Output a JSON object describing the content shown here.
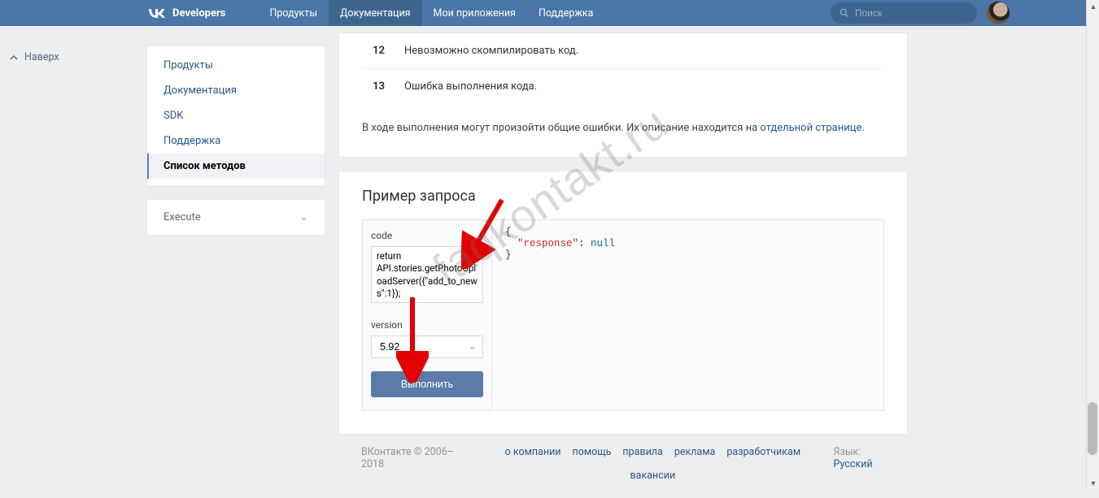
{
  "header": {
    "brand": "Developers",
    "nav": [
      "Продукты",
      "Документация",
      "Мои приложения",
      "Поддержка"
    ],
    "nav_active_index": 1,
    "search_placeholder": "Поиск"
  },
  "naverx_label": "Наверх",
  "sidebar": {
    "items": [
      "Продукты",
      "Документация",
      "SDK",
      "Поддержка",
      "Список методов"
    ],
    "active_index": 4,
    "execute_label": "Execute"
  },
  "errors": [
    {
      "code": "12",
      "text": "Невозможно скомпилировать код."
    },
    {
      "code": "13",
      "text": "Ошибка выполнения кода."
    }
  ],
  "general_errors_prefix": "В ходе выполнения могут произойти общие ошибки. Их описание находится на ",
  "general_errors_link": "отдельной странице",
  "example": {
    "title": "Пример запроса",
    "code_label": "code",
    "code_value": "return API.stories.getPhotoUploadServer({\"add_to_news\":1});",
    "version_label": "version",
    "version_value": "5.92",
    "run_label": "Выполнить",
    "response_key": "\"response\"",
    "response_val": "null"
  },
  "footer": {
    "copyright": "ВКонтакте © 2006–2018",
    "links": [
      "о компании",
      "помощь",
      "правила",
      "реклама",
      "разработчикам",
      "вакансии"
    ],
    "lang_label": "Язык:",
    "lang_value": "Русский"
  },
  "watermark": "faqkontakt.ru"
}
